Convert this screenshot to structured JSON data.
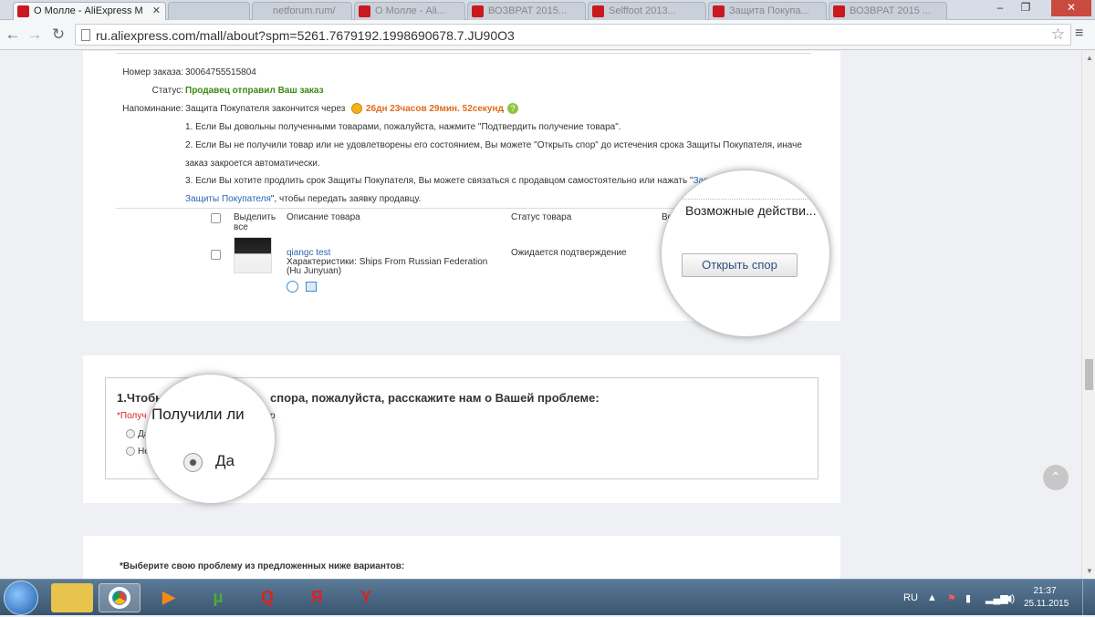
{
  "browser": {
    "active_tab_title": "О Молле - AliExpress Мо",
    "other_tabs": [
      "",
      "",
      "netforum.rum/",
      "О Молле - Ali...",
      "ВОЗВРАТ 2015...",
      "Selffoot 2013...",
      "Защита Покупа...",
      "ВОЗВРАТ 2015 ..."
    ],
    "address_url": "ru.aliexpress.com/mall/about?spm=5261.7679192.1998690678.7.JU90O3"
  },
  "order": {
    "number_label": "Номер заказа:",
    "number_value": "30064755515804",
    "status_label": "Статус:",
    "status_value": "Продавец отправил Ваш заказ",
    "reminder_label": "Напоминание:",
    "reminder_text": "Защита Покупателя закончится через",
    "countdown": "26дн 23часов 29мин. 52секунд",
    "countdown_dot": ".",
    "notes": [
      "1. Если Вы довольны полученными товарами, пожалуйста, нажмите \"Подтвердить получение товара\".",
      "2. Если Вы не получили товар или не удовлетворены его состоянием, Вы можете \"Открыть спор\" до истечения срока Защиты Покупателя, иначе",
      "заказ закроется автоматически.",
      "3. Если Вы хотите продлить срок Защиты Покупателя, Вы можете связаться с продавцом самостоятельно или нажать \""
    ],
    "note3_link": "Запр",
    "note4_link": "Защиты Покупателя",
    "note4_rest": "\", чтобы передать заявку продавцу."
  },
  "table": {
    "headers": {
      "select_all": "Выделить все",
      "description": "Описание товара",
      "status": "Статус товара",
      "actions_cut": "Во"
    },
    "row": {
      "product_name": "qiangc test",
      "characteristics": "Характеристики: Ships From Russian Federation (Hu Junyuan)",
      "status": "Ожидается подтверждение"
    }
  },
  "magnifier_actions": {
    "header": "Возможные действи...",
    "open_dispute_label": "Открыть спор"
  },
  "dispute_form": {
    "heading_left": "1.Чтобы",
    "heading_right": "спора, пожалуйста, расскажите нам о Вашей проблеме:",
    "question_cut": "*Получ",
    "question_tail": "р",
    "option_yes_cut": "Да",
    "option_no_cut": "Не"
  },
  "magnifier_received": {
    "question": "Получили ли",
    "yes_label": "Да"
  },
  "problem_section": {
    "label": "*Выберите свою проблему из предложенных ниже вариантов:"
  },
  "taskbar": {
    "language": "RU",
    "time": "21:37",
    "date": "25.11.2015"
  },
  "colors": {
    "link": "#2a65b3",
    "status_green": "#3a8a11",
    "countdown_orange": "#e16a1a",
    "required_red": "#d9261c"
  }
}
